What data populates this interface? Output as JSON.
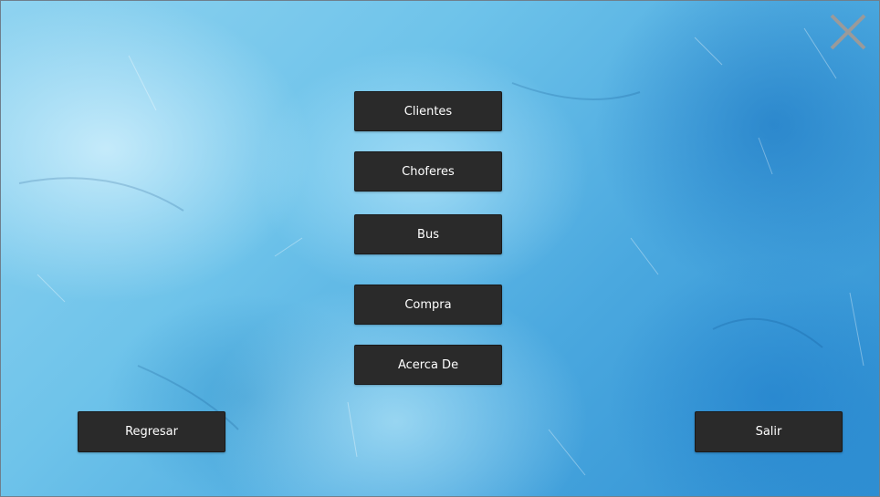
{
  "window": {
    "close_icon": "close-icon"
  },
  "menu": {
    "items": [
      {
        "label": "Clientes"
      },
      {
        "label": "Choferes"
      },
      {
        "label": "Bus"
      },
      {
        "label": "Compra"
      },
      {
        "label": "Acerca De"
      }
    ]
  },
  "footer": {
    "back_label": "Regresar",
    "exit_label": "Salir"
  },
  "colors": {
    "button_bg": "#2a2a2a",
    "button_text": "#ffffff",
    "background_primary": "#4aa8df",
    "close_icon": "#9a9a9a"
  }
}
